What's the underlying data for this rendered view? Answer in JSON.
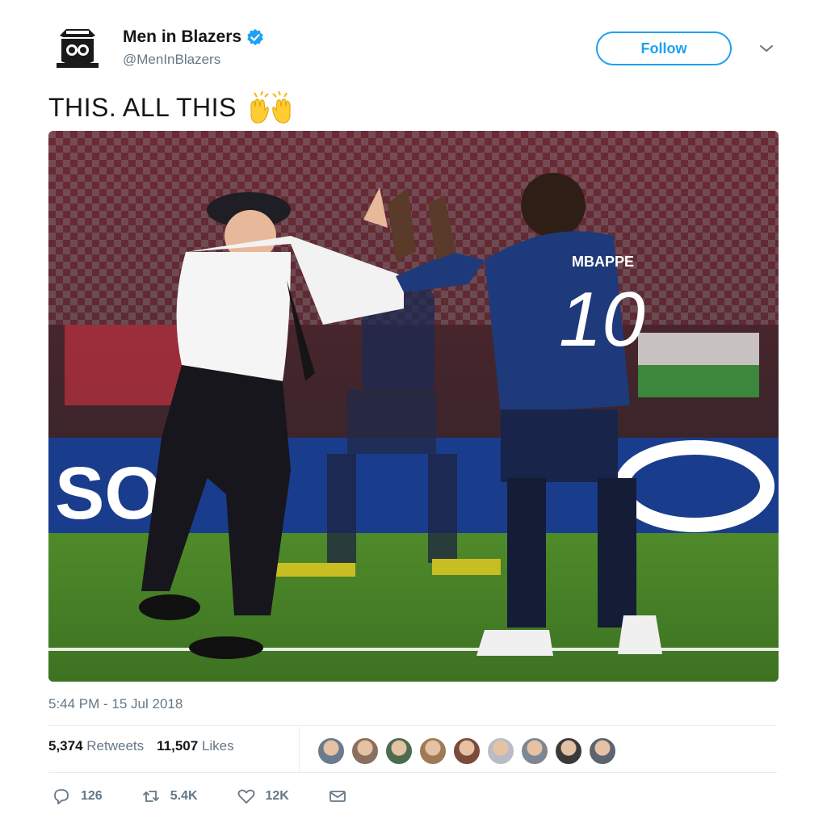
{
  "account": {
    "name": "Men in Blazers",
    "handle": "@MenInBlazers",
    "verified": true
  },
  "follow_label": "Follow",
  "tweet": {
    "text": "THIS. ALL THIS",
    "emoji": "🙌",
    "timestamp": "5:44 PM - 15 Jul 2018"
  },
  "media": {
    "jersey_name": "MBAPPE",
    "jersey_number": "10",
    "board_text": "SOI"
  },
  "stats": {
    "retweets_count": "5,374",
    "retweets_label": "Retweets",
    "likes_count": "11,507",
    "likes_label": "Likes"
  },
  "likers": [
    "#6b7a8c",
    "#8a6f5e",
    "#4d6b4f",
    "#a07a55",
    "#7a4a3a",
    "#b9bcc4",
    "#7c8792",
    "#3a3a3a",
    "#5d6470"
  ],
  "actions": {
    "reply_count": "126",
    "retweet_count": "5.4K",
    "like_count": "12K"
  },
  "colors": {
    "accent": "#1da1f2",
    "text": "#14171a",
    "muted": "#657786"
  }
}
